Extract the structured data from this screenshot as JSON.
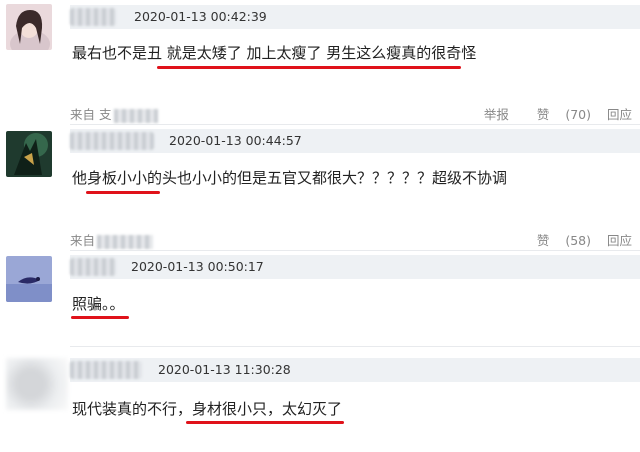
{
  "accent_underline": "#e0121a",
  "comments": [
    {
      "time": "2020-01-13 00:42:39",
      "text": "最右也不是丑 就是太矮了 加上太瘦了 男生这么瘦真的很奇怪",
      "source_label": "来自",
      "source_partial": "支",
      "report_label": "举报",
      "like_label": "赞",
      "like_count": "(70)",
      "reply_label": "回应"
    },
    {
      "time": "2020-01-13 00:44:57",
      "text": "他身板小小的头也小小的但是五官又都很大？？？？？超级不协调",
      "source_label": "来自",
      "like_label": "赞",
      "like_count": "(58)",
      "reply_label": "回应"
    },
    {
      "time": "2020-01-13 00:50:17",
      "text": "照骗。。"
    },
    {
      "time": "2020-01-13 11:30:28",
      "text": "现代装真的不行，身材很小只，太幻灭了"
    }
  ]
}
